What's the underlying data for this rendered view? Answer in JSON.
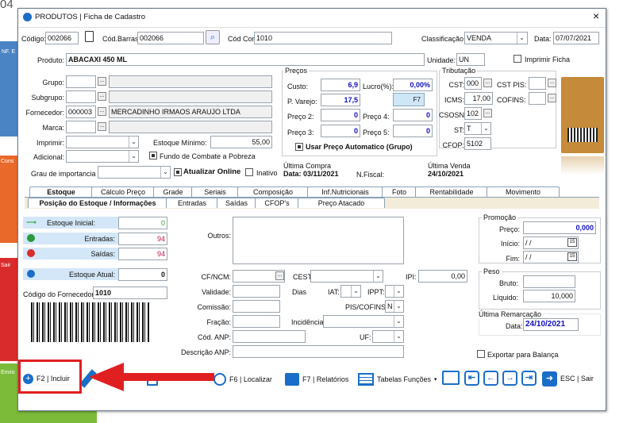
{
  "window": {
    "title": "PRODUTOS | Ficha de Cadastro",
    "outside_corner_text": "04",
    "close": "×"
  },
  "left_bg": {
    "items": [
      "NF. E",
      "Cons",
      "Sair",
      "Envio"
    ]
  },
  "top": {
    "codigo_label": "Código:",
    "codigo": "002066",
    "barras_label": "Cód.Barras:",
    "barras": "002066",
    "cor_label": "Cód Cor:",
    "cor": "1010",
    "class_label": "Classificação:",
    "class": "VENDA",
    "data_label": "Data:",
    "data": "07/07/2021"
  },
  "produto": {
    "label": "Produto:",
    "value": "ABACAXI 450 ML",
    "unidade_label": "Unidade:",
    "unidade": "UN",
    "imprimir_ficha": "Imprimir Ficha"
  },
  "left_fields": {
    "grupo": "Grupo:",
    "subgrupo": "Subgrupo:",
    "fornecedor": "Fornecedor:",
    "fornecedor_cod": "000003",
    "fornecedor_nome": "MERCADINHO IRMAOS ARAUJO LTDA",
    "marca": "Marca:",
    "imprimir": "Imprimir:",
    "estoque_minimo": "Estoque Mínimo:",
    "estoque_minimo_val": "55,00",
    "adicional": "Adicional:",
    "fundo": "Fundo de Combate a Pobreza",
    "grau": "Grau de importancia",
    "atualizar": "Atualizar Online",
    "inativo": "Inativo"
  },
  "precos": {
    "title": "Preços",
    "custo_label": "Custo:",
    "custo": "6,9",
    "lucro_label": "Lucro(%):",
    "lucro": "0,00%",
    "varejo_label": "P. Varejo:",
    "varejo": "17,5",
    "f7": "F7",
    "p2_label": "Preço 2:",
    "p2": "0",
    "p4_label": "Preço 4:",
    "p4": "0",
    "p3_label": "Preço 3:",
    "p3": "0",
    "p5_label": "Preço 5:",
    "p5": "0",
    "auto": "Usar Preço Automatico (Grupo)",
    "ult_compra_label": "Última Compra",
    "ult_compra": "Data: 03/11/2021",
    "nfiscal": "N.Fiscal:"
  },
  "trib": {
    "title": "Tributação",
    "cst_label": "CST:",
    "cst": "000",
    "cstpis_label": "CST PIS:",
    "icms_label": "ICMS:",
    "icms": "17,00",
    "cofins_label": "COFINS:",
    "csosn_label": "CSOSN:",
    "csosn": "102",
    "st_label": "ST:",
    "st": "T",
    "cfop_label": "CFOP:",
    "cfop": "5102",
    "ult_venda_label": "Última Venda",
    "ult_venda": "24/10/2021"
  },
  "tabs1": [
    "Estoque",
    "Cálculo Preço",
    "Grade",
    "Seriais",
    "Composição",
    "Inf.Nutricionais",
    "Foto",
    "Rentabilidade",
    "Movimento"
  ],
  "tabs2": [
    "Posição do Estoque / Informações",
    "Entradas",
    "Saídas",
    "CFOP's",
    "Preço Atacado"
  ],
  "estoque": {
    "inicial_label": "Estoque Inicial:",
    "inicial": "0",
    "entradas_label": "Entradas:",
    "entradas": "94",
    "saidas_label": "Saídas:",
    "saidas": "94",
    "atual_label": "Estoque Atual:",
    "atual": "0",
    "cod_forn_label": "Código do Fornecedor:",
    "cod_forn": "1010"
  },
  "mid": {
    "outros": "Outros:",
    "cfncm": "CF/NCM:",
    "cest": "CEST:",
    "ipi": "IPI:",
    "ipi_val": "0,00",
    "validade": "Validade:",
    "dias": "Dias",
    "iat": "IAT:",
    "ippt": "IPPT:",
    "comissao": "Comissão:",
    "piscofins": "PIS/COFINS:",
    "piscofins_val": "N",
    "fracao": "Fração:",
    "incidencia": "Incidência:",
    "codanp": "Cód. ANP:",
    "uf": "UF:",
    "descanp": "Descrição ANP:"
  },
  "promo": {
    "title": "Promoção",
    "preco_label": "Preço:",
    "preco": "0,000",
    "inicio_label": "Início:",
    "inicio": "/ /",
    "fim_label": "Fim:",
    "fim": "/ /"
  },
  "peso": {
    "title": "Peso",
    "bruto_label": "Bruto:",
    "liquido_label": "Líquido:",
    "liquido": "10,000"
  },
  "remarc": {
    "title": "Última Remarcação",
    "data_label": "Data:",
    "data": "24/10/2021"
  },
  "exportar": "Exportar para Balança",
  "toolbar": {
    "incluir": "F2 | Incluir",
    "localizar": "F6 | Localizar",
    "relatorios": "F7 | Relatórios",
    "tabelas": "Tabelas Funções",
    "sair": "ESC | Sair"
  },
  "colors": {
    "accent": "#1a6ec8",
    "annotation": "#e02020",
    "value_blue": "#1010c0"
  }
}
